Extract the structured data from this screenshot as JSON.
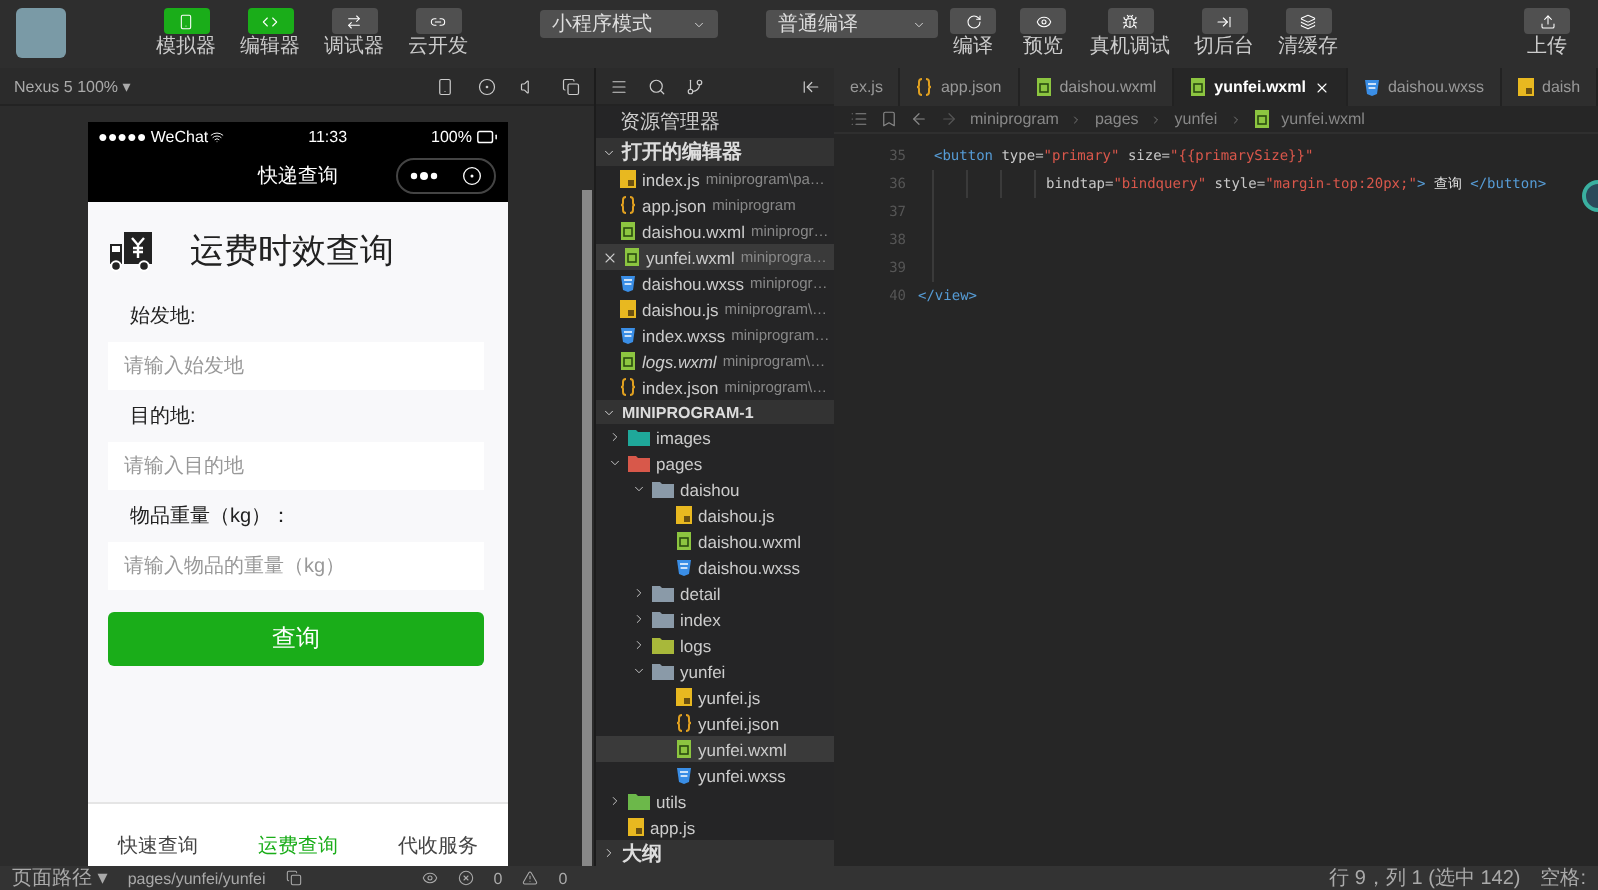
{
  "toolbar": {
    "views": [
      {
        "label": "模拟器",
        "kind": "phone",
        "on": true
      },
      {
        "label": "编辑器",
        "kind": "code",
        "on": true
      },
      {
        "label": "调试器",
        "kind": "debug",
        "on": false
      },
      {
        "label": "云开发",
        "kind": "cloud",
        "on": false
      }
    ],
    "mode": "小程序模式",
    "compile": "普通编译",
    "actions": [
      {
        "label": "编译",
        "kind": "refresh"
      },
      {
        "label": "预览",
        "kind": "eye"
      },
      {
        "label": "真机调试",
        "kind": "bug"
      },
      {
        "label": "切后台",
        "kind": "background"
      },
      {
        "label": "清缓存",
        "kind": "layers"
      }
    ],
    "upload": "上传"
  },
  "simulator": {
    "device": "Nexus 5 100% ▾",
    "phone": {
      "carrier": "●●●●● WeChat",
      "time": "11:33",
      "battery": "100%",
      "nav_title": "快递查询",
      "page_title": "运费时效查询",
      "fields": [
        {
          "label": "始发地:",
          "placeholder": "请输入始发地"
        },
        {
          "label": "目的地:",
          "placeholder": "请输入目的地"
        },
        {
          "label": "物品重量（kg）：",
          "placeholder": "请输入物品的重量（kg）"
        }
      ],
      "button": "查询",
      "tabs": [
        {
          "label": "快速查询",
          "selected": false
        },
        {
          "label": "运费查询",
          "selected": true
        },
        {
          "label": "代收服务",
          "selected": false
        }
      ]
    }
  },
  "explorer": {
    "title": "资源管理器",
    "open_title": "打开的编辑器",
    "open_editors": [
      {
        "name": "index.js",
        "path": "miniprogram\\pa…",
        "kind": "js",
        "selected": false,
        "italic": false
      },
      {
        "name": "app.json",
        "path": "miniprogram",
        "kind": "json",
        "selected": false,
        "italic": false
      },
      {
        "name": "daishou.wxml",
        "path": "miniprogr…",
        "kind": "wxml",
        "selected": false,
        "italic": false
      },
      {
        "name": "yunfei.wxml",
        "path": "miniprogra…",
        "kind": "wxml",
        "selected": true,
        "italic": false
      },
      {
        "name": "daishou.wxss",
        "path": "miniprogr…",
        "kind": "wxss",
        "selected": false,
        "italic": false
      },
      {
        "name": "daishou.js",
        "path": "miniprogram\\…",
        "kind": "js",
        "selected": false,
        "italic": false
      },
      {
        "name": "index.wxss",
        "path": "miniprogram…",
        "kind": "wxss",
        "selected": false,
        "italic": false
      },
      {
        "name": "logs.wxml",
        "path": "miniprogram\\…",
        "kind": "wxml",
        "selected": false,
        "italic": true
      },
      {
        "name": "index.json",
        "path": "miniprogram\\…",
        "kind": "json",
        "selected": false,
        "italic": false
      }
    ],
    "project": "MINIPROGRAM-1",
    "tree": [
      {
        "name": "images",
        "kind": "folder",
        "color": "#1fa89a",
        "expanded": false
      },
      {
        "name": "pages",
        "kind": "folder",
        "color": "#d8584a",
        "expanded": true,
        "children": [
          {
            "name": "daishou",
            "kind": "folder",
            "color": "#8a9aa8",
            "expanded": true,
            "children": [
              {
                "name": "daishou.js",
                "kind": "js",
                "selected": false
              },
              {
                "name": "daishou.wxml",
                "kind": "wxml",
                "selected": false
              },
              {
                "name": "daishou.wxss",
                "kind": "wxss",
                "selected": false
              }
            ]
          },
          {
            "name": "detail",
            "kind": "folder",
            "color": "#8a9aa8",
            "expanded": false
          },
          {
            "name": "index",
            "kind": "folder",
            "color": "#8a9aa8",
            "expanded": false
          },
          {
            "name": "logs",
            "kind": "folder",
            "color": "#a8b83a",
            "expanded": false
          },
          {
            "name": "yunfei",
            "kind": "folder",
            "color": "#8a9aa8",
            "expanded": true,
            "children": [
              {
                "name": "yunfei.js",
                "kind": "js",
                "selected": false
              },
              {
                "name": "yunfei.json",
                "kind": "json",
                "selected": false
              },
              {
                "name": "yunfei.wxml",
                "kind": "wxml",
                "selected": true
              },
              {
                "name": "yunfei.wxss",
                "kind": "wxss",
                "selected": false
              }
            ]
          }
        ]
      },
      {
        "name": "utils",
        "kind": "folder",
        "color": "#6cb84a",
        "expanded": false
      },
      {
        "name": "app.js",
        "kind": "js",
        "selected": false
      }
    ],
    "outline": "大纲"
  },
  "editor": {
    "tabs": [
      {
        "name": "ex.js",
        "kind": "none",
        "selected": false
      },
      {
        "name": "app.json",
        "kind": "json",
        "selected": false
      },
      {
        "name": "daishou.wxml",
        "kind": "wxml",
        "selected": false
      },
      {
        "name": "yunfei.wxml",
        "kind": "wxml",
        "selected": true
      },
      {
        "name": "daishou.wxss",
        "kind": "wxss",
        "selected": false
      },
      {
        "name": "daish",
        "kind": "js",
        "selected": false
      }
    ],
    "breadcrumb": [
      "miniprogram",
      "pages",
      "yunfei",
      "yunfei.wxml"
    ],
    "lines": [
      {
        "number": "35",
        "kind": "nested",
        "segments": [
          {
            "kind": "tag",
            "text": "<button "
          },
          {
            "kind": "attr",
            "text": "type="
          },
          {
            "kind": "str",
            "text": "\"primary\""
          },
          {
            "kind": "attr",
            "text": " size="
          },
          {
            "kind": "str",
            "text": "\"{{primarySize}}\""
          }
        ]
      },
      {
        "number": "36",
        "kind": "wrapped",
        "segments": [
          {
            "kind": "attr",
            "text": "bindtap="
          },
          {
            "kind": "str",
            "text": "\"bindquery\""
          },
          {
            "kind": "attr",
            "text": " style="
          },
          {
            "kind": "str",
            "text": "\"margin-top:20px;\""
          },
          {
            "kind": "tag",
            "text": ">"
          },
          {
            "kind": "text",
            "text": " 查询 "
          },
          {
            "kind": "tag",
            "text": "</button>"
          }
        ]
      },
      {
        "number": "37",
        "kind": "blank"
      },
      {
        "number": "38",
        "kind": "blank"
      },
      {
        "number": "39",
        "kind": "blank"
      },
      {
        "number": "40",
        "kind": "top",
        "segments": [
          {
            "kind": "tag",
            "text": "</view>"
          }
        ]
      }
    ]
  },
  "status_bar": {
    "path_label": "页面路径 ▾",
    "path": "pages/yunfei/yunfei",
    "errors": "0",
    "warnings": "0",
    "position": "行 9，列 1 (选中 142)",
    "indent": "空格:"
  }
}
